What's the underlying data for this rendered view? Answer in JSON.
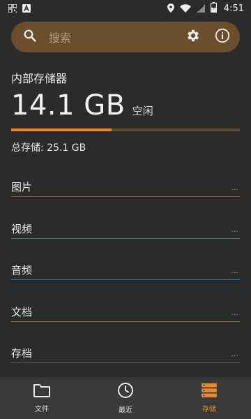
{
  "status_bar": {
    "time": "4:51",
    "battery_level": 0.5
  },
  "search": {
    "placeholder": "搜索"
  },
  "storage": {
    "section_title": "内部存储器",
    "free_value": "14.1 GB",
    "free_label": "空闲",
    "used_fraction": 0.44,
    "total_text": "总存储: 25.1 GB"
  },
  "categories": [
    {
      "label": "图片",
      "color": "#a8453b"
    },
    {
      "label": "视频",
      "color": "#3f7a6a"
    },
    {
      "label": "音频",
      "color": "#3d6a8c"
    },
    {
      "label": "文档",
      "color": "#8a7840"
    },
    {
      "label": "存档",
      "color": "#3f6e58"
    }
  ],
  "more_label": "...",
  "nav": {
    "items": [
      {
        "label": "文件",
        "icon": "folder-icon"
      },
      {
        "label": "最近",
        "icon": "clock-icon"
      },
      {
        "label": "存储",
        "icon": "storage-icon"
      }
    ],
    "active_color": "#e8892c"
  },
  "colors": {
    "background": "#2b2b2b",
    "search_bar": "#6b4e2c",
    "accent": "#e8892c"
  }
}
